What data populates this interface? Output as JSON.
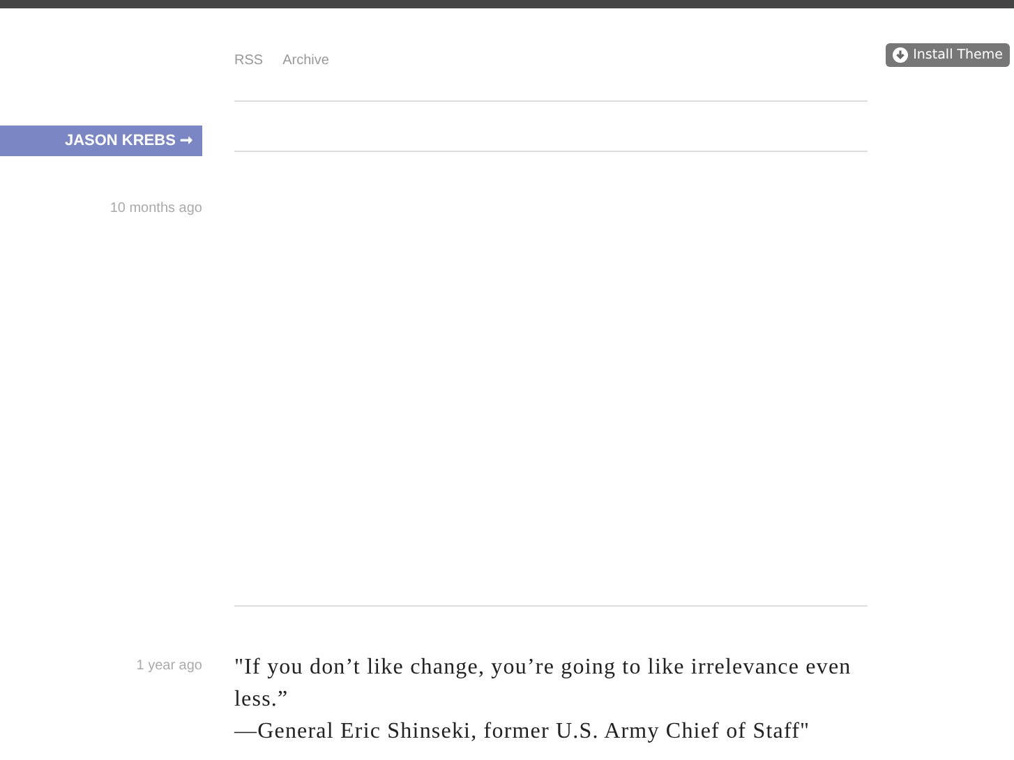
{
  "nav": {
    "links": [
      "RSS",
      "Archive"
    ]
  },
  "install_button": {
    "label": "Install Theme"
  },
  "author": {
    "label": "JASON KREBS ➞"
  },
  "posts": [
    {
      "time": "10 months ago",
      "kind": "empty"
    },
    {
      "time": "1 year ago",
      "kind": "quote",
      "text": "\"If you don’t like change, you’re going to like irrelevance even less.”\n—General Eric Shinseki, former U.S. Army Chief of Staff\""
    }
  ]
}
